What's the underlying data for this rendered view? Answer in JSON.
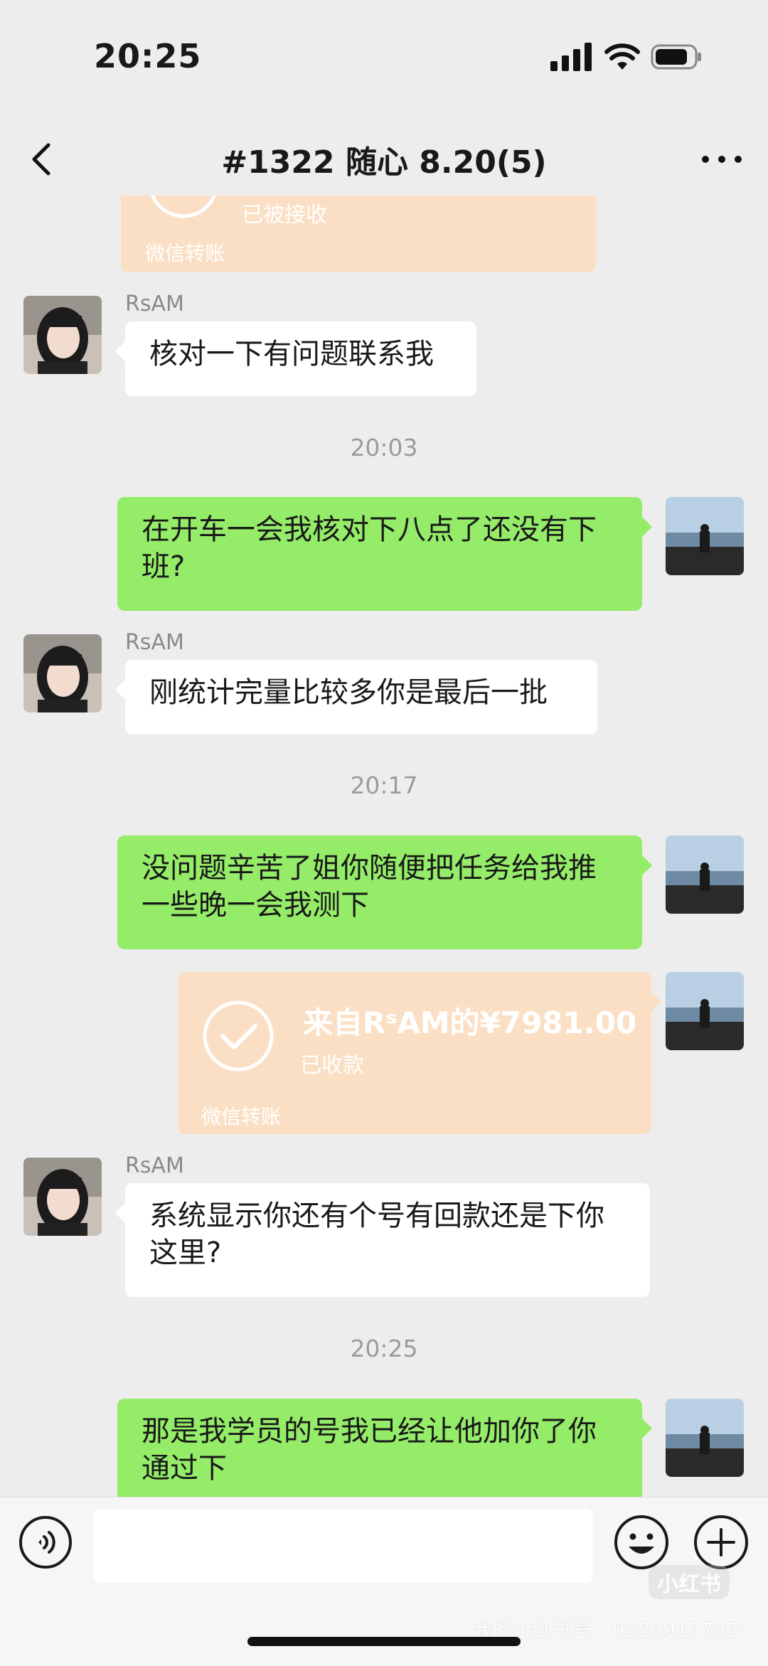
{
  "status_bar": {
    "time": "20:25"
  },
  "header": {
    "title": "#1322 随心 8.20(5)"
  },
  "chat": {
    "partial_transfer": {
      "status": "已被接收",
      "footer": "微信转账"
    },
    "msg1": {
      "sender": "RsAM",
      "text": "核对一下有问题联系我"
    },
    "time1": "20:03",
    "msg2": {
      "text": "在开车一会我核对下八点了还没有下班?"
    },
    "msg3": {
      "sender": "RsAM",
      "text": "刚统计完量比较多你是最后一批"
    },
    "time2": "20:17",
    "msg4": {
      "text": "没问题辛苦了姐你随便把任务给我推一些晚一会我测下"
    },
    "transfer": {
      "amount": "来自RˢAM的¥7981.00",
      "status": "已收款",
      "footer": "微信转账"
    },
    "msg5": {
      "sender": "RsAM",
      "text": "系统显示你还有个号有回款还是下你这里?"
    },
    "time3": "20:25",
    "msg6": {
      "text": "那是我学员的号我已经让他加你了你通过下"
    }
  },
  "input": {
    "value": "",
    "placeholder": ""
  },
  "watermark": {
    "logo": "小红书",
    "text": "我的小红书号：9223913733"
  },
  "colors": {
    "outgoing_bubble": "#95ec69",
    "incoming_bubble": "#ffffff",
    "transfer_card": "#fbdfc4",
    "background": "#ededed"
  }
}
